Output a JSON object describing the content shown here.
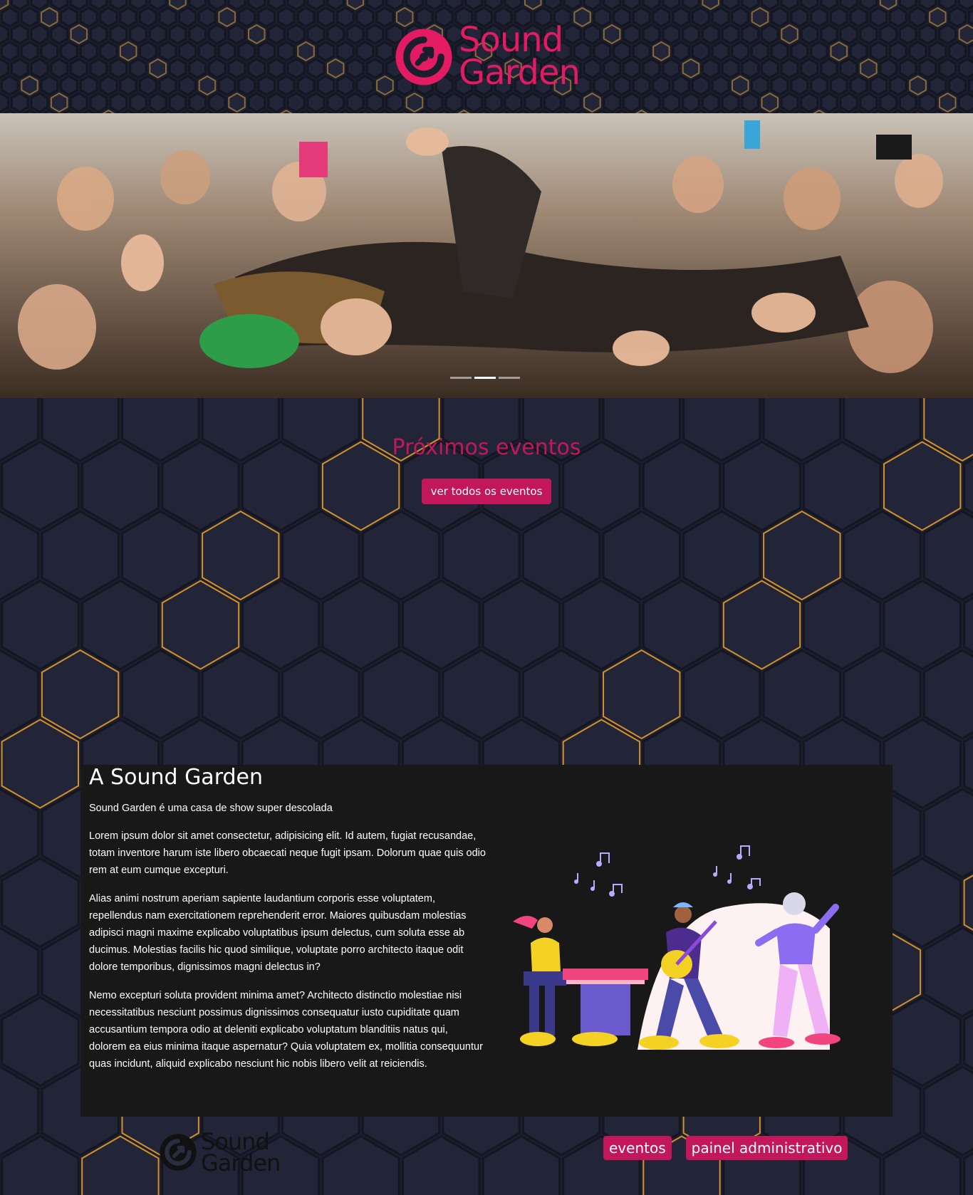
{
  "brand": {
    "name_line1": "Sound",
    "name_line2": "Garden",
    "color": "#e31b63"
  },
  "icons": {
    "logo": "sound-garden-logo-icon"
  },
  "carousel": {
    "slides": 3,
    "active_index": 1
  },
  "events": {
    "title": "Próximos eventos",
    "button_label": "ver todos os eventos"
  },
  "about": {
    "title": "A Sound Garden",
    "subtitle": "Sound Garden é uma casa de show super descolada",
    "paragraphs": [
      "Lorem ipsum dolor sit amet consectetur, adipisicing elit. Id autem, fugiat recusandae, totam inventore harum iste libero obcaecati neque fugit ipsam. Dolorum quae quis odio rem at eum cumque excepturi.",
      "Alias animi nostrum aperiam sapiente laudantium corporis esse voluptatem, repellendus nam exercitationem reprehenderit error. Maiores quibusdam molestias adipisci magni maxime explicabo voluptatibus ipsum delectus, cum soluta esse ab ducimus. Molestias facilis hic quod similique, voluptate porro architecto itaque odit dolore temporibus, dignissimos magni delectus in?",
      "Nemo excepturi soluta provident minima amet? Architecto distinctio molestiae nisi necessitatibus nesciunt possimus dignissimos consequatur iusto cupiditate quam accusantium tempora odio at deleniti explicabo voluptatum blanditiis natus qui, dolorem ea eius minima itaque aspernatur? Quia voluptatem ex, mollitia consequuntur quas incidunt, aliquid explicabo nesciunt hic nobis libero velit at reiciendis."
    ]
  },
  "footer": {
    "nav": [
      "eventos",
      "painel administrativo"
    ]
  },
  "colors": {
    "accent": "#c2185b",
    "background": "#1c1f2e",
    "panel": "#181818",
    "hex_glow": "#d4902a"
  }
}
